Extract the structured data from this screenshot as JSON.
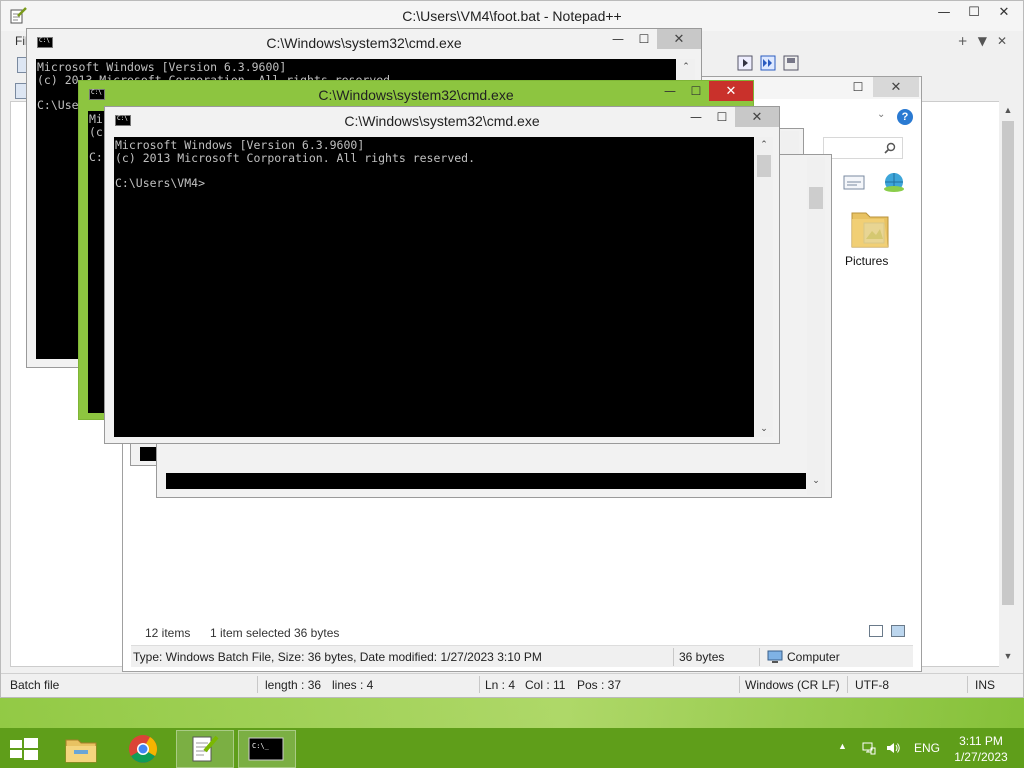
{
  "notepad": {
    "title": "C:\\Users\\VM4\\foot.bat - Notepad++",
    "menu_first": "Fil",
    "tab_controls": [
      "+",
      "▼",
      "✕"
    ],
    "statusbar": {
      "type": "Batch file",
      "length": "length : 36",
      "lines": "lines : 4",
      "ln": "Ln : 4",
      "col": "Col : 11",
      "pos": "Pos : 37",
      "eol": "Windows (CR LF)",
      "encoding": "UTF-8",
      "mode": "INS"
    }
  },
  "explorer": {
    "folder_label": "Pictures",
    "item_count": "12 items",
    "selected": "1 item selected",
    "selected_size": "36 bytes",
    "details": "Type: Windows Batch File, Size: 36 bytes, Date modified: 1/27/2023 3:10 PM",
    "details_size": "36 bytes",
    "details_location": "Computer"
  },
  "cmd_windows": [
    {
      "title": "C:\\Windows\\system32\\cmd.exe",
      "lines": [
        "Microsoft Windows [Version 6.3.9600]",
        "(c) 2013 Microsoft Corporation. All rights reserved.",
        "",
        "C:\\Users"
      ]
    },
    {
      "title": "C:\\Windows\\system32\\cmd.exe",
      "lines": [
        "Mi",
        "(c",
        "",
        "C:"
      ]
    },
    {
      "title": "C:\\Windows\\system32\\cmd.exe",
      "lines": [
        "Microsoft Windows [Version 6.3.9600]",
        "(c) 2013 Microsoft Corporation. All rights reserved.",
        "",
        "C:\\Users\\VM4>"
      ]
    }
  ],
  "window_controls": {
    "minimize": "—",
    "maximize": "☐",
    "close": "✕"
  },
  "taskbar": {
    "apps": [
      "file-explorer",
      "chrome",
      "notepad-plus-plus",
      "command-prompt"
    ],
    "language": "ENG",
    "time": "3:11 PM",
    "date": "1/27/2023"
  }
}
